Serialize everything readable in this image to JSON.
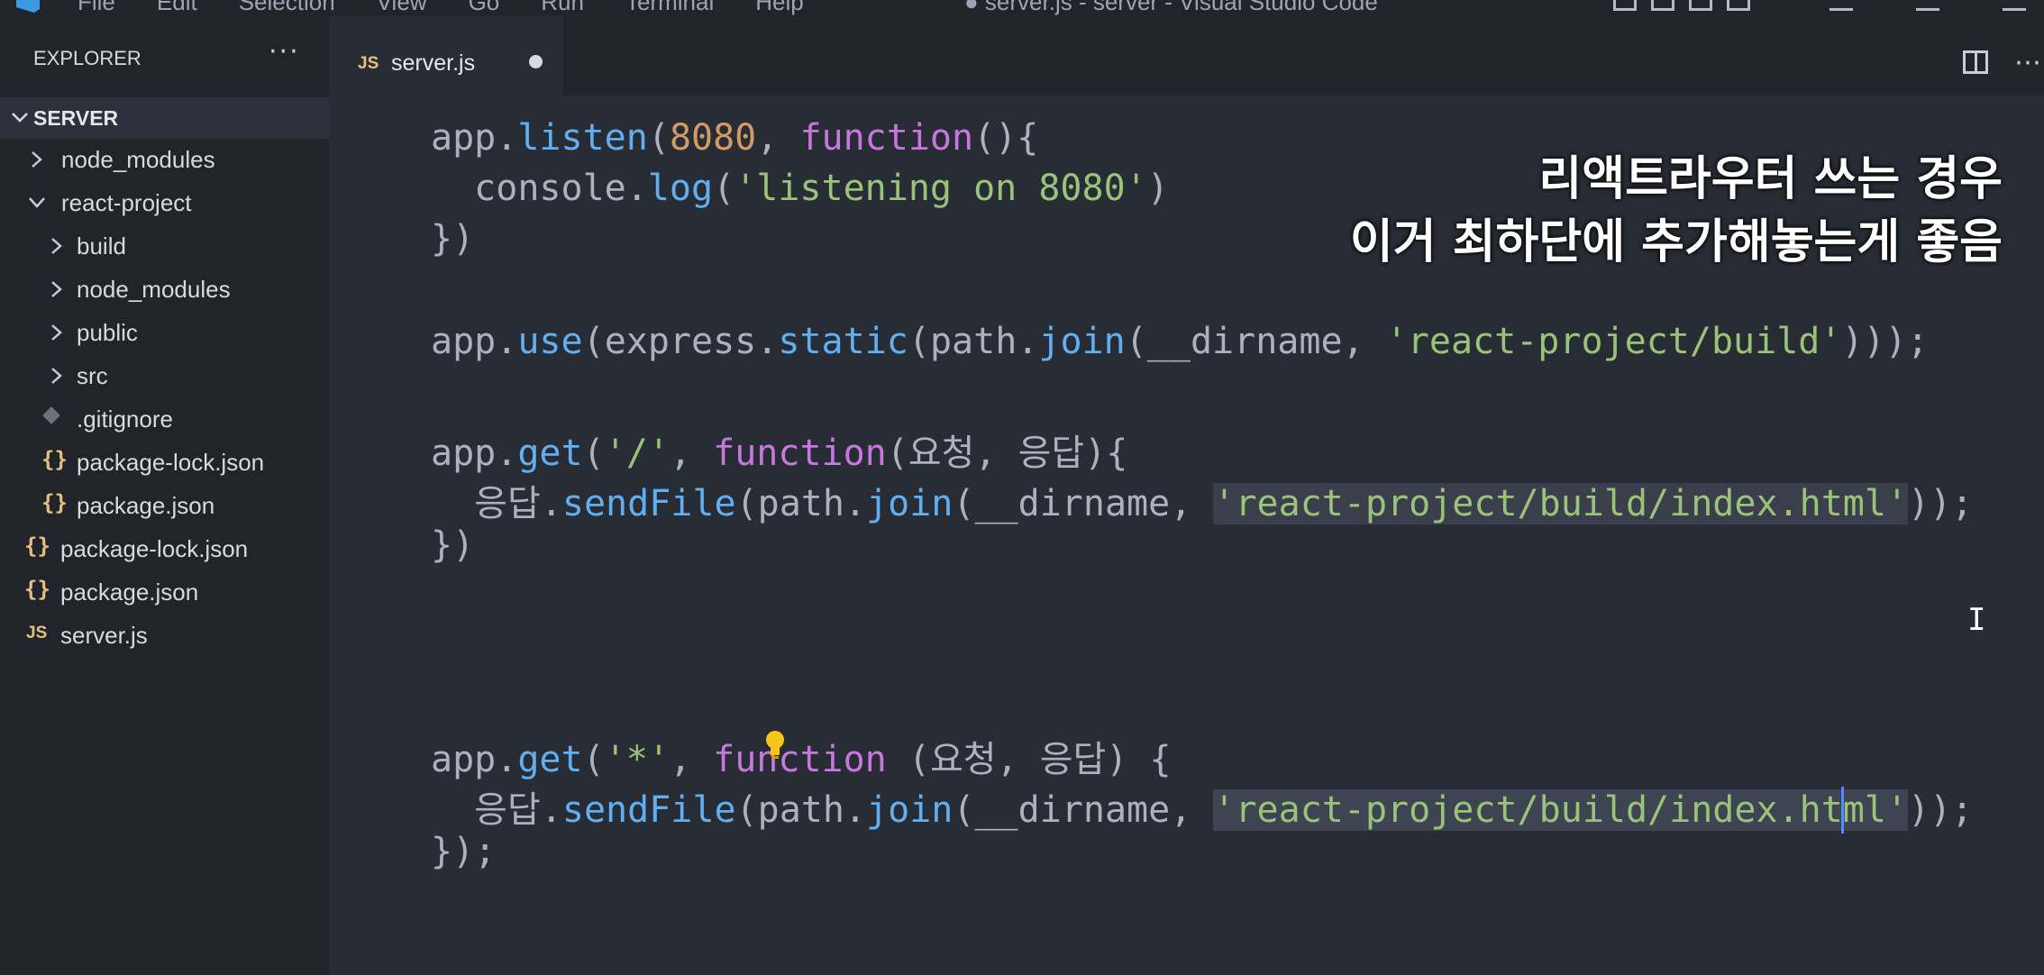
{
  "titlebar": {
    "menu": [
      "File",
      "Edit",
      "Selection",
      "View",
      "Go",
      "Run",
      "Terminal",
      "Help"
    ],
    "title": "● server.js - server - Visual Studio Code"
  },
  "sidebar": {
    "title": "EXPLORER",
    "more": "···",
    "root": "SERVER",
    "items": [
      {
        "label": "node_modules",
        "type": "folder"
      },
      {
        "label": "react-project",
        "type": "folder-open"
      },
      {
        "label": "build",
        "type": "folder"
      },
      {
        "label": "node_modules",
        "type": "folder"
      },
      {
        "label": "public",
        "type": "folder"
      },
      {
        "label": "src",
        "type": "folder"
      },
      {
        "label": ".gitignore",
        "type": "git"
      },
      {
        "label": "package-lock.json",
        "type": "json"
      },
      {
        "label": "package.json",
        "type": "json"
      },
      {
        "label": "package-lock.json",
        "type": "json"
      },
      {
        "label": "package.json",
        "type": "json"
      },
      {
        "label": "server.js",
        "type": "js"
      }
    ]
  },
  "tab": {
    "icon": "JS",
    "label": "server.js",
    "dirty": true
  },
  "editor": {
    "tokens": {
      "app": "app",
      "dot": ".",
      "listen": "listen",
      "lparen": "(",
      "rparen": ")",
      "n8080": "8080",
      "comma_sp": ", ",
      "function": "function",
      "function_sp": "function ",
      "paren_brace": "(){",
      "console": "console",
      "log": "log",
      "str_listening": "'listening on 8080'",
      "close_paren_brace": "})",
      "close_brace_paren_semi": "});",
      "use": "use",
      "express": "express",
      "static": "static",
      "path": "path",
      "join": "join",
      "dirname": "__dirname",
      "str_build": "'react-project/build'",
      "close3": ")));",
      "get": "get",
      "str_root": "'/'",
      "str_star": "'*'",
      "params1": "(요청, 응답){",
      "params2": "(요청, 응답) {",
      "res": "응답",
      "sendFile": "sendFile",
      "str_index": "'react-project/build/index.html'",
      "close2": "));",
      "indent": "  "
    }
  },
  "caption": {
    "line1": "리액트라우터 쓰는 경우",
    "line2": "이거 최하단에 추가해놓는게 좋음"
  },
  "colors": {
    "function": "#61afef",
    "number": "#d19a66",
    "keyword": "#c678dd",
    "string": "#98c379",
    "text": "#abb2bf"
  },
  "icons": [
    "vscode-logo-icon",
    "chevron-right-icon",
    "chevron-down-icon",
    "json-braces-icon",
    "js-file-icon",
    "git-file-icon",
    "split-editor-icon",
    "more-actions-icon",
    "lightbulb-icon",
    "text-cursor-icon"
  ]
}
